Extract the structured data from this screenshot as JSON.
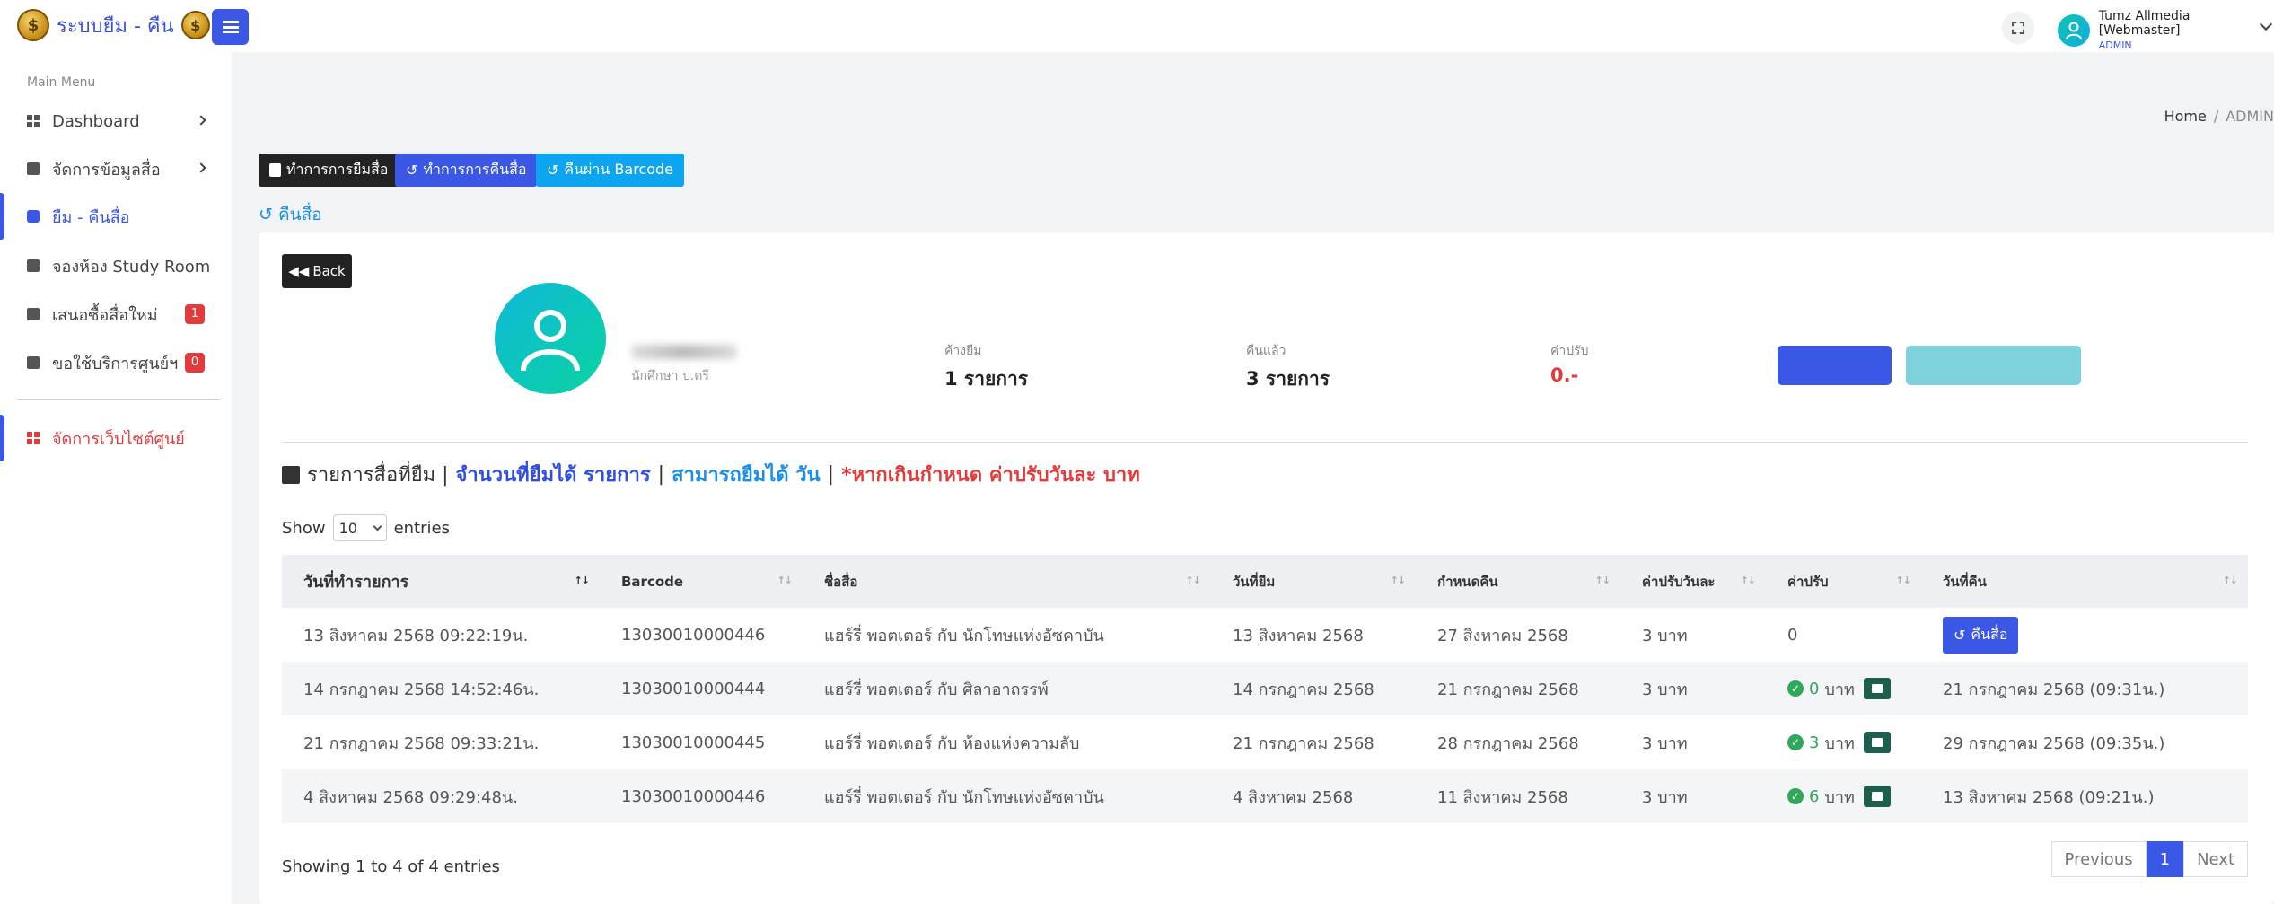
{
  "app": {
    "title": "ระบบยืม - คืน",
    "coin_glyph": "$"
  },
  "user": {
    "name": "Tumz Allmedia [Webmaster]",
    "role": "ADMIN"
  },
  "sidebar": {
    "heading": "Main Menu",
    "items": [
      {
        "label": "Dashboard"
      },
      {
        "label": "จัดการข้อมูลสื่อ"
      },
      {
        "label": "ยืม - คืนสื่อ"
      },
      {
        "label": "จองห้อง Study Room"
      },
      {
        "label": "เสนอซื้อสื่อใหม่",
        "badge": "1"
      },
      {
        "label": "ขอใช้บริการศูนย์ฯ",
        "badge": "0"
      },
      {
        "label": "จัดการเว็บไซต์ศูนย์"
      }
    ]
  },
  "breadcrumb": {
    "home": "Home",
    "sep": "/",
    "current": "ADMIN"
  },
  "actions": {
    "borrow": "ทำการการยืมสื่อ",
    "return": "ทำการการคืนสื่อ",
    "barcode": "คืนผ่าน Barcode"
  },
  "page": {
    "heading": "คืนสื่อ"
  },
  "profile": {
    "back_label": "Back",
    "student_type": "นักศึกษา ป.ตรี",
    "stats": [
      {
        "label": "ค้างยืม",
        "value": "1 รายการ"
      },
      {
        "label": "คืนแล้ว",
        "value": "3 รายการ"
      },
      {
        "label": "ค่าปรับ",
        "value": "0.-"
      }
    ]
  },
  "borrow_list": {
    "title_prefix": "รายการสื่อที่ยืม |",
    "allowed": "จำนวนที่ยืมได้ รายการ",
    "sep": "|",
    "days": "สามารถยืมได้ วัน",
    "sep2": "|",
    "fine_note": "*หากเกินกำหนด ค่าปรับวันละ บาท"
  },
  "entries": {
    "show": "Show",
    "value": "10",
    "suffix": "entries"
  },
  "table": {
    "headers": [
      "วันที่ทำรายการ",
      "Barcode",
      "ชื่อสื่อ",
      "วันที่ยืม",
      "กำหนดคืน",
      "ค่าปรับวันละ",
      "ค่าปรับ",
      "วันที่คืน"
    ],
    "sort_glyph": "↑↓",
    "unit": "บาท",
    "return_label": "คืนสื่อ",
    "rows": [
      {
        "date": "13 สิงหาคม 2568 09:22:19น.",
        "barcode": "13030010000446",
        "title": "แฮร์รี่ พอตเตอร์ กับ นักโทษแห่งอัซคาบัน",
        "borrow": "13 สิงหาคม 2568",
        "due": "27 สิงหาคม 2568",
        "rate": "3 บาท",
        "fine": "0",
        "returned": ""
      },
      {
        "date": "14 กรกฎาคม 2568 14:52:46น.",
        "barcode": "13030010000444",
        "title": "แฮร์รี่ พอตเตอร์ กับ ศิลาอาถรรพ์",
        "borrow": "14 กรกฎาคม 2568",
        "due": "21 กรกฎาคม 2568",
        "rate": "3 บาท",
        "fine": "0",
        "returned": "21 กรกฎาคม 2568 (09:31น.)"
      },
      {
        "date": "21 กรกฎาคม 2568 09:33:21น.",
        "barcode": "13030010000445",
        "title": "แฮร์รี่ พอตเตอร์ กับ ห้องแห่งความลับ",
        "borrow": "21 กรกฎาคม 2568",
        "due": "28 กรกฎาคม 2568",
        "rate": "3 บาท",
        "fine": "3",
        "returned": "29 กรกฎาคม 2568 (09:35น.)"
      },
      {
        "date": "4 สิงหาคม 2568 09:29:48น.",
        "barcode": "13030010000446",
        "title": "แฮร์รี่ พอตเตอร์ กับ นักโทษแห่งอัซคาบัน",
        "borrow": "4 สิงหาคม 2568",
        "due": "11 สิงหาคม 2568",
        "rate": "3 บาท",
        "fine": "6",
        "returned": "13 สิงหาคม 2568 (09:21น.)"
      }
    ]
  },
  "footer": {
    "showing": "Showing 1 to 4 of 4 entries",
    "previous": "Previous",
    "page": "1",
    "next": "Next"
  },
  "colors": {
    "primary": "#3b57e6",
    "info": "#1b8ee8",
    "danger": "#e23b3b",
    "success": "#2fa85a"
  }
}
